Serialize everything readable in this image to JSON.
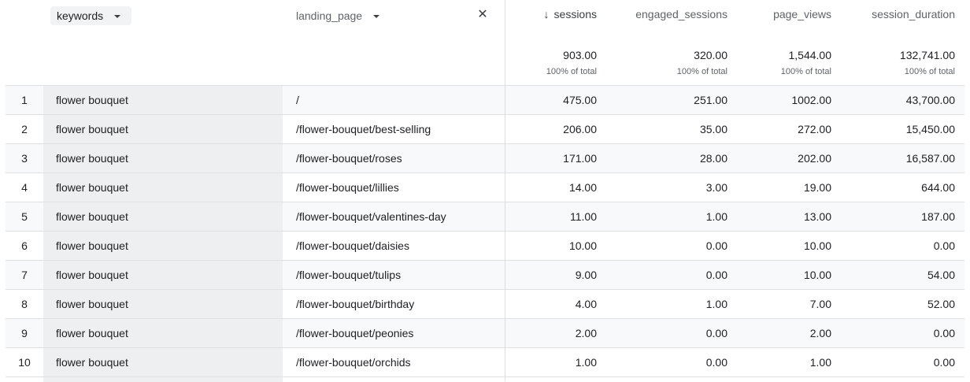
{
  "header": {
    "dim1_label": "keywords",
    "dim2_label": "landing_page",
    "close_glyph": "✕",
    "sort_arrow": "↓",
    "metrics": [
      {
        "label": "sessions",
        "total": "903.00",
        "pct": "100% of total"
      },
      {
        "label": "engaged_sessions",
        "total": "320.00",
        "pct": "100% of total"
      },
      {
        "label": "page_views",
        "total": "1,544.00",
        "pct": "100% of total"
      },
      {
        "label": "session_duration",
        "total": "132,741.00",
        "pct": "100% of total"
      }
    ]
  },
  "rows": [
    {
      "idx": "1",
      "keyword": "flower bouquet",
      "landing": "/",
      "sessions": "475.00",
      "engaged": "251.00",
      "views": "1002.00",
      "duration": "43,700.00"
    },
    {
      "idx": "2",
      "keyword": "flower bouquet",
      "landing": "/flower-bouquet/best-selling",
      "sessions": "206.00",
      "engaged": "35.00",
      "views": "272.00",
      "duration": "15,450.00"
    },
    {
      "idx": "3",
      "keyword": "flower bouquet",
      "landing": "/flower-bouquet/roses",
      "sessions": "171.00",
      "engaged": "28.00",
      "views": "202.00",
      "duration": "16,587.00"
    },
    {
      "idx": "4",
      "keyword": "flower bouquet",
      "landing": "/flower-bouquet/lillies",
      "sessions": "14.00",
      "engaged": "3.00",
      "views": "19.00",
      "duration": "644.00"
    },
    {
      "idx": "5",
      "keyword": "flower bouquet",
      "landing": "/flower-bouquet/valentines-day",
      "sessions": "11.00",
      "engaged": "1.00",
      "views": "13.00",
      "duration": "187.00"
    },
    {
      "idx": "6",
      "keyword": "flower bouquet",
      "landing": "/flower-bouquet/daisies",
      "sessions": "10.00",
      "engaged": "0.00",
      "views": "10.00",
      "duration": "0.00"
    },
    {
      "idx": "7",
      "keyword": "flower bouquet",
      "landing": "/flower-bouquet/tulips",
      "sessions": "9.00",
      "engaged": "0.00",
      "views": "10.00",
      "duration": "54.00"
    },
    {
      "idx": "8",
      "keyword": "flower bouquet",
      "landing": "/flower-bouquet/birthday",
      "sessions": "4.00",
      "engaged": "1.00",
      "views": "7.00",
      "duration": "52.00"
    },
    {
      "idx": "9",
      "keyword": "flower bouquet",
      "landing": "/flower-bouquet/peonies",
      "sessions": "2.00",
      "engaged": "0.00",
      "views": "2.00",
      "duration": "0.00"
    },
    {
      "idx": "10",
      "keyword": "flower bouquet",
      "landing": "/flower-bouquet/orchids",
      "sessions": "1.00",
      "engaged": "0.00",
      "views": "1.00",
      "duration": "0.00"
    }
  ]
}
